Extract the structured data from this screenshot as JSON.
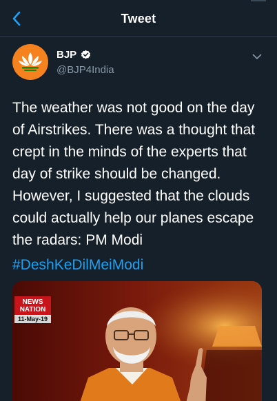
{
  "header": {
    "title": "Tweet",
    "back_icon": "chevron-left-icon"
  },
  "author": {
    "display_name": "BJP",
    "handle": "@BJP4India",
    "verified_icon": "verified-badge-icon",
    "avatar_icon": "lotus-logo-icon",
    "more_icon": "chevron-down-icon"
  },
  "tweet": {
    "text": "The weather was not good on the day of Airstrikes. There was a thought that crept in the minds of the experts that day of strike should be changed. However, I suggested that the clouds could actually help our planes escape the radars: PM Modi",
    "hashtag": "#DeshKeDilMeiModi"
  },
  "media": {
    "logo_line1": "NEWS",
    "logo_line2": "NATION",
    "logo_date": "11-May-19"
  },
  "colors": {
    "background": "#15202b",
    "accent": "#1da1f2",
    "secondary_text": "#8899a6",
    "avatar_bg": "#f5821f"
  }
}
